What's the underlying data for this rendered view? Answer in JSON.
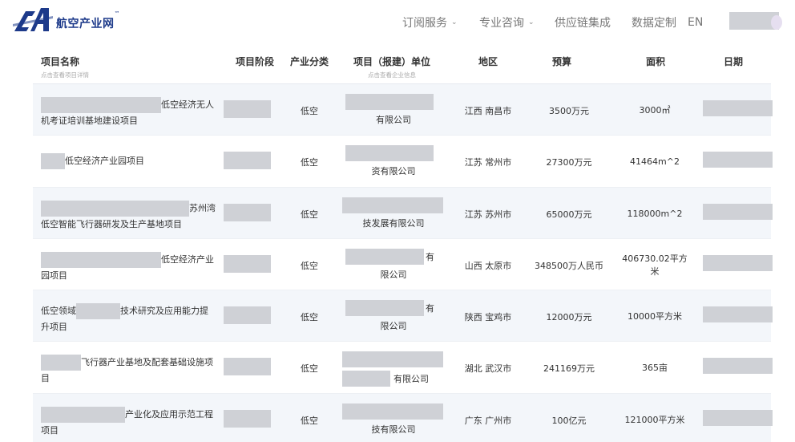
{
  "header": {
    "logo_text": "航空产业网",
    "logo_tm": "™",
    "nav": [
      {
        "label": "订阅服务",
        "dropdown": true
      },
      {
        "label": "专业咨询",
        "dropdown": true
      },
      {
        "label": "供应链集成",
        "dropdown": false
      },
      {
        "label": "数据定制",
        "dropdown": false
      },
      {
        "label": "EN",
        "dropdown": false
      }
    ]
  },
  "table": {
    "columns": {
      "name": "项目名称",
      "name_hint": "点击查看项目详情",
      "stage": "项目阶段",
      "category": "产业分类",
      "unit": "项目（报建）单位",
      "unit_hint": "点击查看企业信息",
      "region": "地区",
      "budget": "预算",
      "area": "面积",
      "date": "日期"
    },
    "rows": [
      {
        "name_a": "低空经济无人",
        "name_b": "机考证培训基地建设项目",
        "category": "低空",
        "unit": "有限公司",
        "region": "江西 南昌市",
        "budget": "3500万元",
        "area": "3000㎡"
      },
      {
        "name_a": "低空经济产业园项目",
        "name_b": "",
        "category": "低空",
        "unit": "资有限公司",
        "region": "江苏 常州市",
        "budget": "27300万元",
        "area": "41464m^2"
      },
      {
        "name_a": "苏州湾",
        "name_b": "低空智能飞行器研发及生产基地项目",
        "category": "低空",
        "unit": "技发展有限公司",
        "region": "江苏 苏州市",
        "budget": "65000万元",
        "area": "118000m^2"
      },
      {
        "name_a": "低空经济产业",
        "name_b": "园项目",
        "category": "低空",
        "unit_a": "有",
        "unit": "限公司",
        "region": "山西 太原市",
        "budget": "348500万人民币",
        "area": "406730.02平方米"
      },
      {
        "name_pre": "低空领域",
        "name_a": "技术研究及应用能力提",
        "name_b": "升项目",
        "category": "低空",
        "unit_a": "有",
        "unit": "限公司",
        "region": "陕西 宝鸡市",
        "budget": "12000万元",
        "area": "10000平方米"
      },
      {
        "name_a": "飞行器产业基地及配套基础设施项",
        "name_b": "目",
        "category": "低空",
        "unit": "有限公司",
        "region": "湖北 武汉市",
        "budget": "241169万元",
        "area": "365亩"
      },
      {
        "name_a": "产业化及应用示范工程",
        "name_b": "项目",
        "category": "低空",
        "unit": "技有限公司",
        "region": "广东 广州市",
        "budget": "100亿元",
        "area": "121000平方米"
      }
    ]
  },
  "colors": {
    "brand": "#1d3a8a",
    "redaction": "#cfd1d6",
    "row_alt": "#f3f6fa"
  }
}
